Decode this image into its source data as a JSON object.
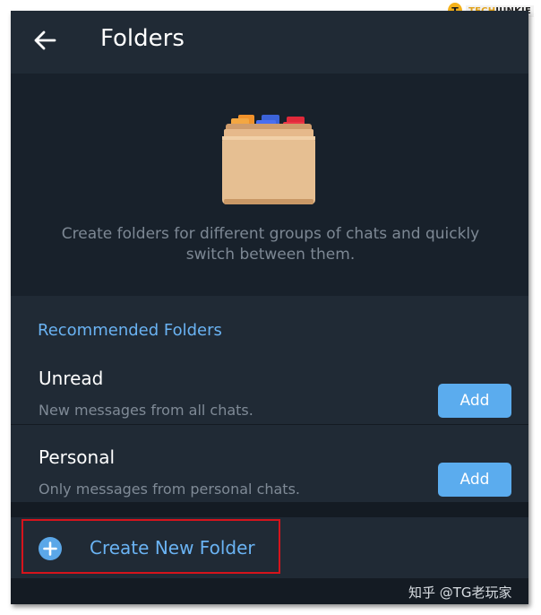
{
  "header": {
    "title": "Folders"
  },
  "hero": {
    "text": "Create folders for different groups of chats and quickly switch between them."
  },
  "recommended": {
    "title": "Recommended Folders",
    "items": [
      {
        "name": "Unread",
        "description": "New messages from all chats.",
        "button_label": "Add"
      },
      {
        "name": "Personal",
        "description": "Only messages from personal chats.",
        "button_label": "Add"
      }
    ]
  },
  "create": {
    "label": "Create New Folder"
  },
  "logo": {
    "badge": "T",
    "prefix": "TECH",
    "suffix": "JUNKIE"
  },
  "watermark": "知乎 @TG老玩家",
  "colors": {
    "background": "#1a222c",
    "panel": "#202a35",
    "accent": "#6ab3f3",
    "button": "#5bacee",
    "highlight": "#d6141c"
  },
  "icons": [
    "back-arrow-icon",
    "folder-illustration",
    "plus-icon"
  ]
}
